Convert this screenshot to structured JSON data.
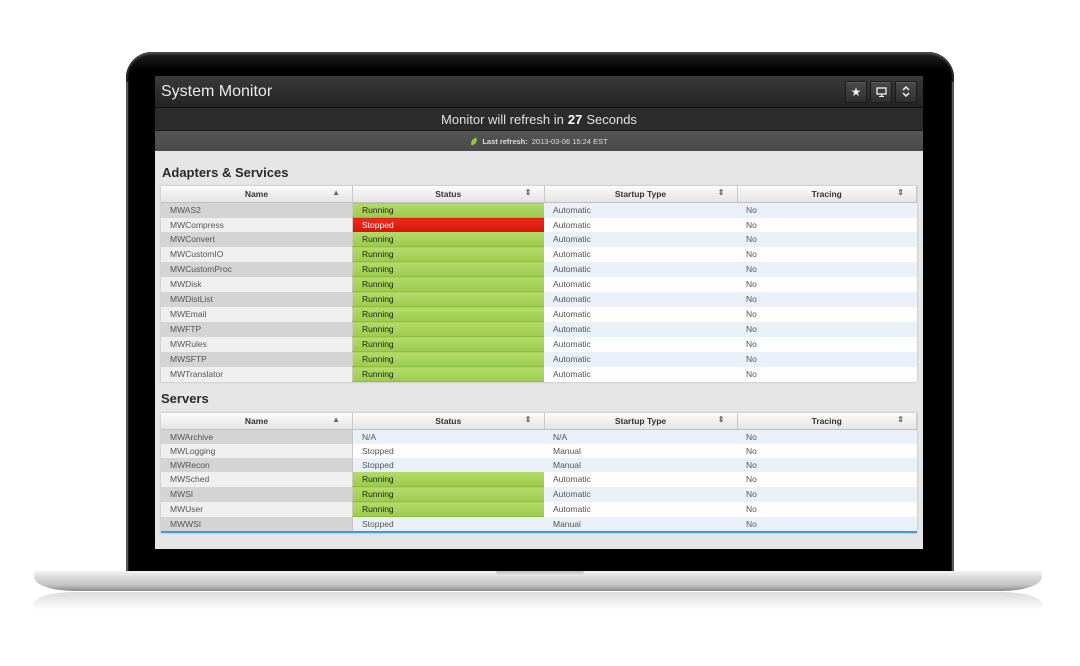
{
  "app": {
    "title": "System Monitor",
    "buttons": [
      {
        "name": "favorite",
        "icon": "star-icon",
        "glyph": "★"
      },
      {
        "name": "display",
        "icon": "monitor-icon",
        "glyph": "🖵"
      },
      {
        "name": "expand",
        "icon": "updown-chevron-icon",
        "glyph": "⇕"
      }
    ]
  },
  "refresh": {
    "prefix": "Monitor will refresh in",
    "seconds": "27",
    "suffix": "Seconds",
    "last_label": "Last refresh:",
    "last_value": "2013-03-06 15:24 EST"
  },
  "adapters": {
    "title": "Adapters & Services",
    "columns": [
      {
        "label": "Name",
        "sort": "▲"
      },
      {
        "label": "Status",
        "sort": "⇕"
      },
      {
        "label": "Startup Type",
        "sort": "⇕"
      },
      {
        "label": "Tracing",
        "sort": "⇕"
      }
    ],
    "rows": [
      {
        "name": "MWAS2",
        "status": "Running",
        "startup": "Automatic",
        "tracing": "No"
      },
      {
        "name": "MWCompress",
        "status": "Stopped",
        "startup": "Automatic",
        "tracing": "No"
      },
      {
        "name": "MWConvert",
        "status": "Running",
        "startup": "Automatic",
        "tracing": "No"
      },
      {
        "name": "MWCustomIO",
        "status": "Running",
        "startup": "Automatic",
        "tracing": "No"
      },
      {
        "name": "MWCustomProc",
        "status": "Running",
        "startup": "Automatic",
        "tracing": "No"
      },
      {
        "name": "MWDisk",
        "status": "Running",
        "startup": "Automatic",
        "tracing": "No"
      },
      {
        "name": "MWDistList",
        "status": "Running",
        "startup": "Automatic",
        "tracing": "No"
      },
      {
        "name": "MWEmail",
        "status": "Running",
        "startup": "Automatic",
        "tracing": "No"
      },
      {
        "name": "MWFTP",
        "status": "Running",
        "startup": "Automatic",
        "tracing": "No"
      },
      {
        "name": "MWRules",
        "status": "Running",
        "startup": "Automatic",
        "tracing": "No"
      },
      {
        "name": "MWSFTP",
        "status": "Running",
        "startup": "Automatic",
        "tracing": "No"
      },
      {
        "name": "MWTranslator",
        "status": "Running",
        "startup": "Automatic",
        "tracing": "No"
      }
    ]
  },
  "servers": {
    "title": "Servers",
    "columns": [
      {
        "label": "Name",
        "sort": "▲"
      },
      {
        "label": "Status",
        "sort": "⇕"
      },
      {
        "label": "Startup Type",
        "sort": "⇕"
      },
      {
        "label": "Tracing",
        "sort": "⇕"
      }
    ],
    "rows": [
      {
        "name": "MWArchive",
        "status": "N/A",
        "startup": "N/A",
        "tracing": "No"
      },
      {
        "name": "MWLogging",
        "status": "Stopped",
        "startup": "Manual",
        "tracing": "No"
      },
      {
        "name": "MWRecon",
        "status": "Stopped",
        "startup": "Manual",
        "tracing": "No"
      },
      {
        "name": "MWSched",
        "status": "Running",
        "startup": "Automatic",
        "tracing": "No"
      },
      {
        "name": "MWSI",
        "status": "Running",
        "startup": "Automatic",
        "tracing": "No"
      },
      {
        "name": "MWUser",
        "status": "Running",
        "startup": "Automatic",
        "tracing": "No"
      },
      {
        "name": "MWWSI",
        "status": "Stopped",
        "startup": "Manual",
        "tracing": "No"
      }
    ]
  },
  "colors": {
    "running": "#a8d45c",
    "stopped_alert": "#e81d12",
    "accent": "#3a9bd8"
  }
}
